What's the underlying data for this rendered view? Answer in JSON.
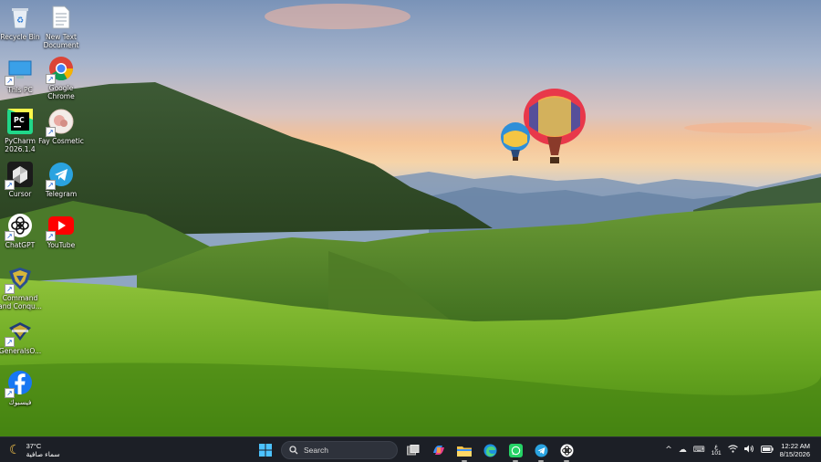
{
  "desktop_icons": [
    {
      "label": "Recycle Bin",
      "icon": "recycle-bin-icon"
    },
    {
      "label": "New Text Document",
      "icon": "text-document-icon"
    },
    {
      "label": "This PC",
      "icon": "this-pc-icon"
    },
    {
      "label": "Google Chrome",
      "icon": "chrome-icon"
    },
    {
      "label": "PyCharm 2026.1.4",
      "icon": "pycharm-icon"
    },
    {
      "label": "Fay Cosmetic",
      "icon": "fay-cosmetic-icon"
    },
    {
      "label": "Cursor",
      "icon": "cursor-icon"
    },
    {
      "label": "Telegram",
      "icon": "telegram-icon"
    },
    {
      "label": "ChatGPT",
      "icon": "chatgpt-icon"
    },
    {
      "label": "YouTube",
      "icon": "youtube-icon"
    },
    {
      "label": "Command and Conqu...",
      "icon": "command-conquer-icon"
    },
    {
      "label": "GeneralsO...",
      "icon": "generals-icon"
    },
    {
      "label": "فيسبوك",
      "icon": "facebook-icon"
    }
  ],
  "taskbar": {
    "weather": {
      "temp": "37°C",
      "condition": "سماء صافية",
      "icon": "moon-icon"
    },
    "search_label": "Search",
    "apps": [
      "start-icon",
      "task-view-icon",
      "copilot-icon",
      "file-explorer-icon",
      "edge-icon",
      "whatsapp-icon",
      "telegram-icon",
      "chatgpt-icon"
    ],
    "tray": {
      "chevron": "^",
      "keyboard_lang": "ع",
      "keyboard_code": "101",
      "time": "12:22 AM",
      "date": "8/15/2026"
    }
  },
  "colors": {
    "taskbar_bg": "#1c1f26",
    "accent": "#0067c0"
  }
}
